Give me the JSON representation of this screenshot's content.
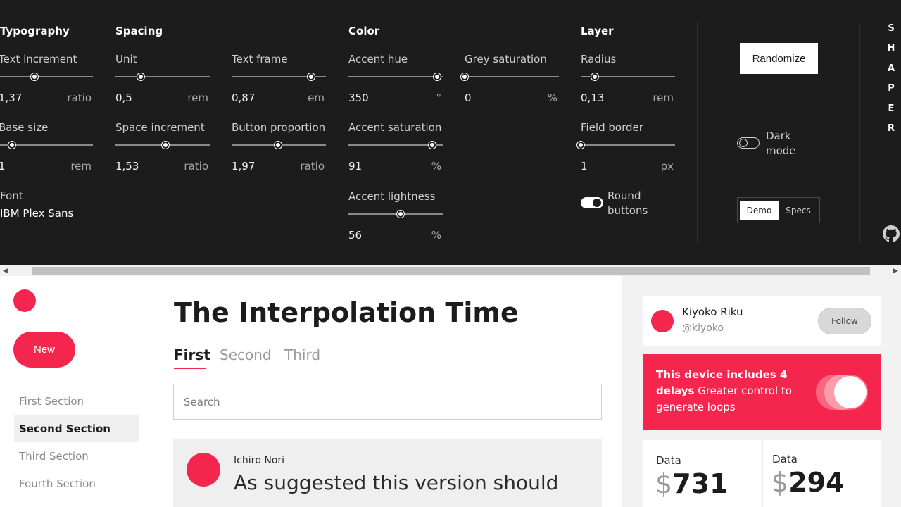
{
  "panel": {
    "sections": {
      "typography": "Typography",
      "spacing": "Spacing",
      "color": "Color",
      "layer": "Layer"
    },
    "controls": [
      {
        "id": "text-increment",
        "label": "Text increment",
        "value": "1,37",
        "unit": "ratio",
        "level": 0.38
      },
      {
        "id": "base-size",
        "label": "Base size",
        "value": "1",
        "unit": "rem",
        "level": 0.14
      },
      {
        "id": "unit",
        "label": "Unit",
        "value": "0,5",
        "unit": "rem",
        "level": 0.27
      },
      {
        "id": "space-increment",
        "label": "Space increment",
        "value": "1,53",
        "unit": "ratio",
        "level": 0.53
      },
      {
        "id": "text-frame",
        "label": "Text frame",
        "value": "0,87",
        "unit": "em",
        "level": 0.84
      },
      {
        "id": "button-proportion",
        "label": "Button proportion",
        "value": "1,97",
        "unit": "ratio",
        "level": 0.49
      },
      {
        "id": "accent-hue",
        "label": "Accent hue",
        "value": "350",
        "unit": "°",
        "level": 0.94
      },
      {
        "id": "accent-saturation",
        "label": "Accent saturation",
        "value": "91",
        "unit": "%",
        "level": 0.89
      },
      {
        "id": "accent-lightness",
        "label": "Accent lightness",
        "value": "56",
        "unit": "%",
        "level": 0.55
      },
      {
        "id": "grey-saturation",
        "label": "Grey saturation",
        "value": "0",
        "unit": "%",
        "level": 0.0
      },
      {
        "id": "radius",
        "label": "Radius",
        "value": "0,13",
        "unit": "rem",
        "level": 0.15
      },
      {
        "id": "field-border",
        "label": "Field border",
        "value": "1",
        "unit": "px",
        "level": 0.0
      }
    ],
    "font": {
      "label": "Font",
      "value": "IBM Plex Sans"
    },
    "round_buttons": {
      "label_1": "Round",
      "label_2": "buttons",
      "on": true
    },
    "dark_mode": {
      "label_1": "Dark",
      "label_2": "mode",
      "on": false
    },
    "randomize_label": "Randomize",
    "view_switch": {
      "demo": "Demo",
      "specs": "Specs",
      "selected": "Demo"
    },
    "brand_letters": [
      "S",
      "H",
      "A",
      "P",
      "E",
      "R"
    ],
    "github_icon": "github-icon"
  },
  "demo": {
    "accent": "#f5264e",
    "sidebar": {
      "new_label": "New",
      "items": [
        "First Section",
        "Second Section",
        "Third Section",
        "Fourth Section"
      ],
      "active_item": "Second Section"
    },
    "main": {
      "title": "The Interpolation Time",
      "tabs": [
        "First",
        "Second",
        "Third"
      ],
      "active_tab": "First",
      "search_placeholder": "Search",
      "post": {
        "author": "Ichirō Nori",
        "text": "As suggested this version should"
      }
    },
    "right": {
      "profile": {
        "name": "Kiyoko Riku",
        "handle": "@kiyoko",
        "follow_label": "Follow"
      },
      "promo": {
        "bold": "This device includes 4 delays",
        "rest": " Greater control to generate loops",
        "toggle_on": true
      },
      "data": [
        {
          "label": "Data",
          "currency": "$",
          "value": "731"
        },
        {
          "label": "Data",
          "currency": "$",
          "value": "294"
        }
      ]
    }
  }
}
